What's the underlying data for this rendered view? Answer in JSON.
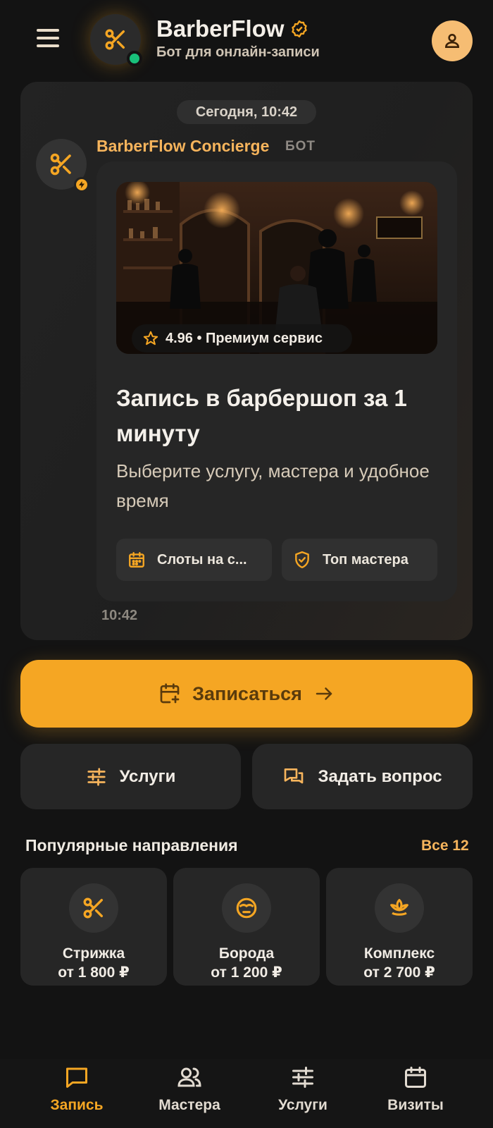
{
  "header": {
    "title": "BarberFlow",
    "subtitle": "Бот для онлайн-записи"
  },
  "chat": {
    "date_label": "Сегодня, 10:42",
    "bot_name": "BarberFlow Concierge",
    "bot_tag": "БОТ",
    "rating_text": "4.96 • Премиум сервис",
    "card_title": "Запись в барбершоп за 1 минуту",
    "card_description": "Выберите услугу, мастера и удобное время",
    "chips": [
      {
        "label": "Слоты на с...",
        "icon": "calendar-icon"
      },
      {
        "label": "Топ мастера",
        "icon": "shield-check-icon"
      }
    ],
    "time": "10:42"
  },
  "actions": {
    "primary_label": "Записаться",
    "services_label": "Услуги",
    "ask_label": "Задать вопрос"
  },
  "popular": {
    "title": "Популярные направления",
    "see_all": "Все 12",
    "items": [
      {
        "name": "Стрижка",
        "price": "от 1 800 ₽",
        "icon": "scissors-icon"
      },
      {
        "name": "Борода",
        "price": "от 1 200 ₽",
        "icon": "beard-face-icon"
      },
      {
        "name": "Комплекс",
        "price": "от 2 700 ₽",
        "icon": "lotus-icon"
      }
    ]
  },
  "nav": [
    {
      "label": "Запись",
      "icon": "chat-icon",
      "active": true
    },
    {
      "label": "Мастера",
      "icon": "users-icon",
      "active": false
    },
    {
      "label": "Услуги",
      "icon": "sliders-icon",
      "active": false
    },
    {
      "label": "Визиты",
      "icon": "calendar-icon",
      "active": false
    }
  ],
  "colors": {
    "accent": "#f5a623",
    "background": "#131313",
    "card": "#262626",
    "online": "#19c07a"
  }
}
